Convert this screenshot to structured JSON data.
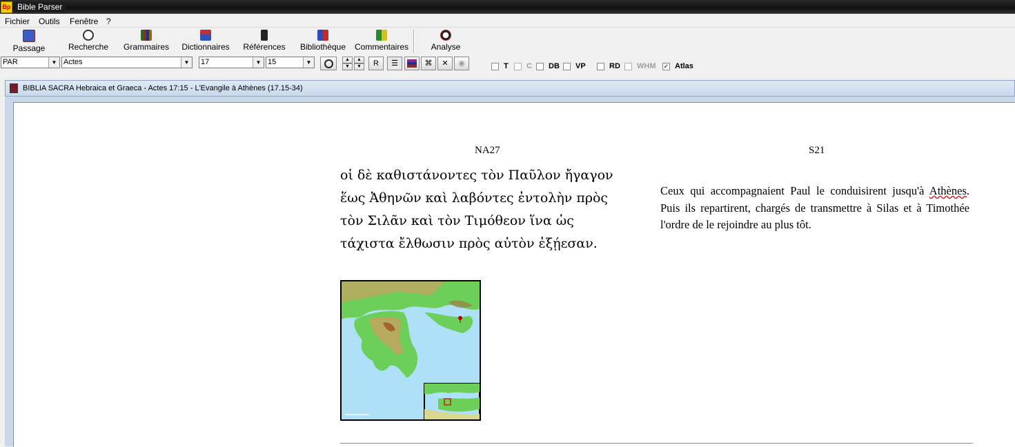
{
  "window": {
    "title": "Bible Parser"
  },
  "menu": {
    "items": [
      "Fichier",
      "Outils",
      "Fenêtre",
      "?"
    ]
  },
  "toolbar": {
    "buttons": [
      "Passage",
      "Recherche",
      "Grammaires",
      "Dictionnaires",
      "Références",
      "Bibliothèque",
      "Commentaires",
      "Analyse"
    ]
  },
  "selectors": {
    "version": "PAR",
    "book": "Actes",
    "chapter": "17",
    "verse": "15",
    "r_button": "R"
  },
  "checkboxes": [
    {
      "label": "T",
      "checked": false,
      "enabled": true
    },
    {
      "label": "C",
      "checked": false,
      "enabled": false
    },
    {
      "label": "DB",
      "checked": false,
      "enabled": true
    },
    {
      "label": "VP",
      "checked": false,
      "enabled": true
    },
    {
      "label": "RD",
      "checked": false,
      "enabled": true
    },
    {
      "label": "WHM",
      "checked": false,
      "enabled": false
    },
    {
      "label": "Atlas",
      "checked": true,
      "enabled": true
    }
  ],
  "document": {
    "window_title": "BIBLIA SACRA Hebraica et Graeca - Actes 17:15 - L'Evangile à Athènes (17.15-34)",
    "left_header": "NA27",
    "right_header": "S21",
    "greek_text": "οἱ δὲ καθιστάνοντες τὸν Παῦλον ἤγαγον ἕως Ἀθηνῶν καὶ λαβόντες ἐντολὴν πρὸς τὸν Σιλᾶν καὶ τὸν Τιμόθεον ἵνα ὡς τάχιστα ἔλθωσιν πρὸς αὐτὸν ἐξῄεσαν.",
    "french_before": "Ceux qui accompagnaient Paul le conduisirent jusqu'à ",
    "french_place": "Athènes",
    "french_after": ". Puis ils repartirent, chargés de transmettre à Silas et à Timothée l'ordre de le rejoindre au plus tôt."
  },
  "colors": {
    "titlebar": "#1c1c1c",
    "mdi_title": "#c9d9ec",
    "map_sea": "#aee0f7",
    "map_land": "#5ccb5c",
    "marker": "#c00000"
  }
}
